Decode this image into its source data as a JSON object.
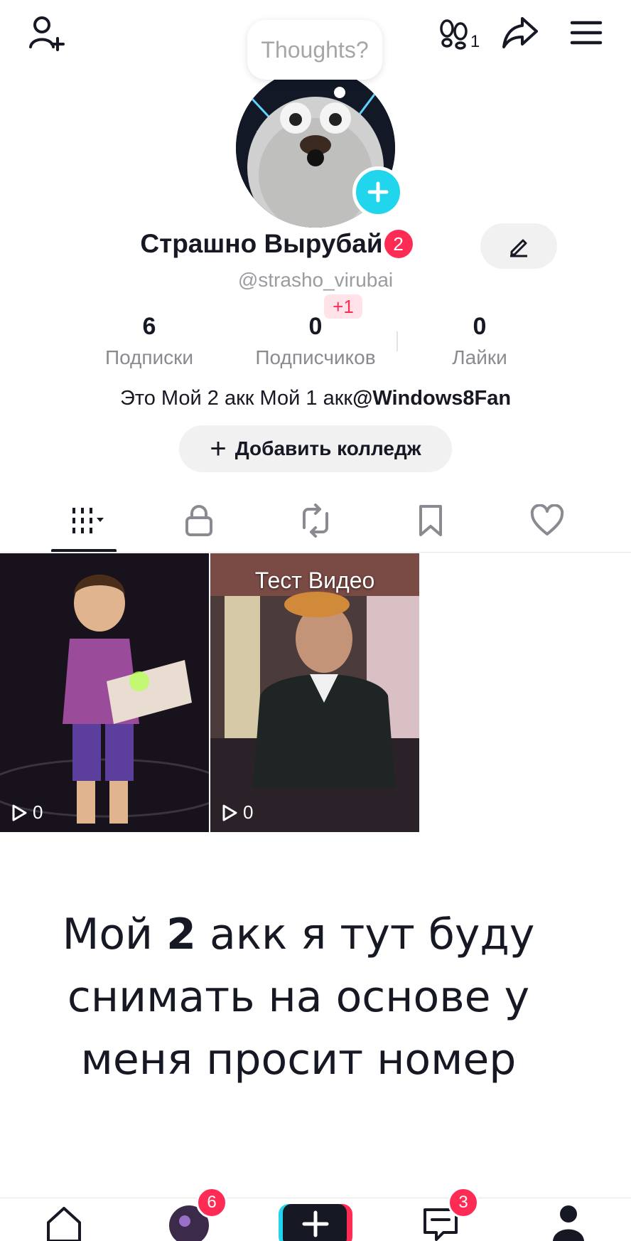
{
  "header": {
    "thoughts_prompt": "Thoughts?",
    "visitors_count": "1"
  },
  "profile": {
    "display_name": "Страшно Вырубай",
    "name_badge": "2",
    "username": "@strasho_virubai",
    "followers_delta": "+1",
    "stats": [
      {
        "value": "6",
        "label": "Подписки"
      },
      {
        "value": "0",
        "label": "Подписчиков"
      },
      {
        "value": "0",
        "label": "Лайки"
      }
    ],
    "bio_text": "Это Мой 2 акк Мой 1 акк",
    "bio_mention": "@Windows8Fan",
    "add_college_label": "Добавить колледж"
  },
  "videos": [
    {
      "title": "",
      "views": "0"
    },
    {
      "title": "Тест Видео",
      "views": "0"
    }
  ],
  "caption": {
    "part1": "Мой ",
    "bold": "2",
    "part2": " акк я тут буду снимать на основе у меня просит номер"
  },
  "bottom_nav": {
    "friends_badge": "6",
    "inbox_badge": "3"
  },
  "colors": {
    "accent_red": "#fe2c55",
    "accent_cyan": "#20d5ec",
    "text_primary": "#161823",
    "text_secondary": "#8a8b91"
  }
}
